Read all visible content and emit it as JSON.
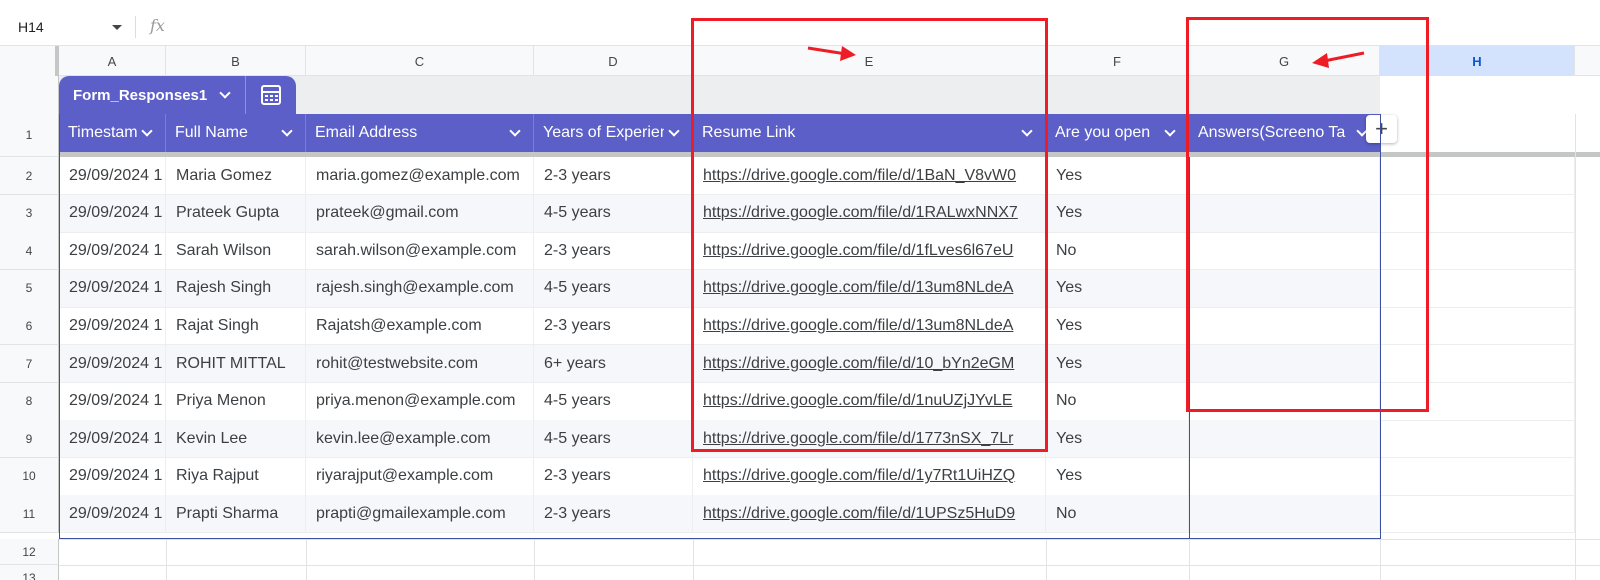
{
  "formula_bar": {
    "cell_ref": "H14",
    "fx_symbol": "fx",
    "formula": ""
  },
  "columns": [
    "A",
    "B",
    "C",
    "D",
    "E",
    "F",
    "G",
    "H"
  ],
  "selected_column": "H",
  "table": {
    "name": "Form_Responses1",
    "headers": [
      "Timestamp",
      "Full Name",
      "Email Address",
      "Years of Experience",
      "Resume Link",
      "Are you open",
      "Answers(Screeno Ta"
    ],
    "add_column_symbol": "+",
    "rows": [
      {
        "num": "2",
        "cells": [
          "29/09/2024 1",
          "Maria Gomez",
          "maria.gomez@example.com",
          "2-3 years",
          "https://drive.google.com/file/d/1BaN_V8vW0",
          "Yes",
          ""
        ]
      },
      {
        "num": "3",
        "cells": [
          "29/09/2024 1",
          "Prateek Gupta",
          "prateek@gmail.com",
          "4-5 years",
          "https://drive.google.com/file/d/1RALwxNNX7",
          "Yes",
          ""
        ]
      },
      {
        "num": "4",
        "cells": [
          "29/09/2024 1",
          "Sarah Wilson",
          "sarah.wilson@example.com",
          "2-3 years",
          "https://drive.google.com/file/d/1fLves6l67eU",
          "No",
          ""
        ]
      },
      {
        "num": "5",
        "cells": [
          "29/09/2024 1",
          "Rajesh Singh",
          "rajesh.singh@example.com",
          "4-5 years",
          "https://drive.google.com/file/d/13um8NLdeA",
          "Yes",
          ""
        ]
      },
      {
        "num": "6",
        "cells": [
          "29/09/2024 1",
          "Rajat Singh",
          "Rajatsh@example.com",
          "2-3 years",
          "https://drive.google.com/file/d/13um8NLdeA",
          "Yes",
          ""
        ]
      },
      {
        "num": "7",
        "cells": [
          "29/09/2024 1",
          "ROHIT MITTAL",
          "rohit@testwebsite.com",
          "6+ years",
          "https://drive.google.com/file/d/10_bYn2eGM",
          "Yes",
          ""
        ]
      },
      {
        "num": "8",
        "cells": [
          "29/09/2024 1",
          "Priya Menon",
          "priya.menon@example.com",
          "4-5 years",
          "https://drive.google.com/file/d/1nuUZjJYvLE",
          "No",
          ""
        ]
      },
      {
        "num": "9",
        "cells": [
          "29/09/2024 1",
          "Kevin Lee",
          "kevin.lee@example.com",
          "4-5 years",
          "https://drive.google.com/file/d/1773nSX_7Lr",
          "Yes",
          ""
        ]
      },
      {
        "num": "10",
        "cells": [
          "29/09/2024 1",
          "Riya Rajput",
          "riyarajput@example.com",
          "2-3 years",
          "https://drive.google.com/file/d/1y7Rt1UiHZQ",
          "Yes",
          ""
        ]
      },
      {
        "num": "11",
        "cells": [
          "29/09/2024 1",
          "Prapti Sharma",
          "prapti@gmailexample.com",
          "2-3 years",
          "https://drive.google.com/file/d/1UPSz5HuD9",
          "No",
          ""
        ]
      }
    ]
  },
  "row_numbers": [
    "1",
    "12",
    "13"
  ],
  "colors": {
    "table_header": "#5b5fc7",
    "annotation": "#ee1c24",
    "selected_col": "#d3e3fd"
  }
}
